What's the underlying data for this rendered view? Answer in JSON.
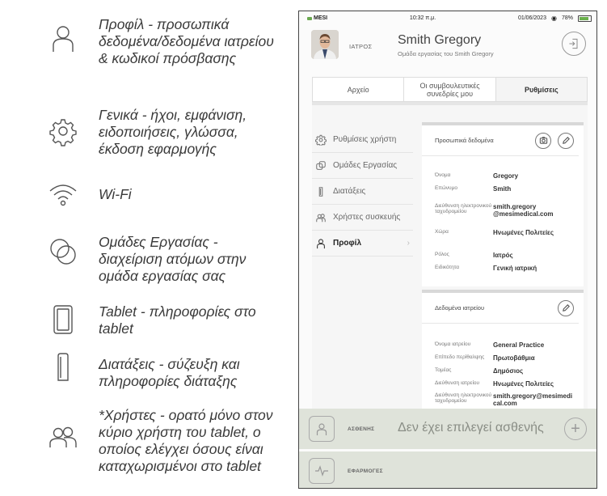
{
  "legend": [
    {
      "icon": "user-icon",
      "text": "Προφίλ - προσωπικά δεδομένα/δεδομένα ιατρείου & κωδικοί πρόσβασης"
    },
    {
      "icon": "gear-icon",
      "text": "Γενικά - ήχοι, εμφάνιση, ειδοποιήσεις, γλώσσα, έκδοση εφαρμογής"
    },
    {
      "icon": "wifi-icon",
      "text": "Wi-Fi"
    },
    {
      "icon": "workgroups-icon",
      "text": "Ομάδες Εργασίας - διαχείριση ατόμων στην ομάδα εργασίας σας"
    },
    {
      "icon": "tablet-icon",
      "text": "Tablet - πληροφορίες στο tablet"
    },
    {
      "icon": "device-icon",
      "text": "Διατάξεις - σύζευξη και πληροφορίες διάταξης"
    },
    {
      "icon": "users-icon",
      "text": "*Χρήστες - ορατό μόνο στον κύριο χρήστη του tablet, ο οποίος ελέγχει όσους είναι καταχωρισμένοι στο tablet"
    }
  ],
  "status": {
    "carrier": "MESI",
    "time": "10:32 π.μ.",
    "date": "01/06/2023",
    "battery": "78%"
  },
  "doctor": {
    "role": "ΙΑΤΡΟΣ",
    "name": "Smith Gregory",
    "group": "Ομάδα εργασίας του Smith Gregory"
  },
  "tabs": [
    "Αρχείο",
    "Οι συμβουλευτικές συνεδρίες μου",
    "Ρυθμίσεις"
  ],
  "menu": [
    {
      "icon": "gear-icon",
      "label": "Ρυθμίσεις χρήστη"
    },
    {
      "icon": "workgroups-icon",
      "label": "Ομάδες Εργασίας"
    },
    {
      "icon": "device-icon",
      "label": "Διατάξεις"
    },
    {
      "icon": "users-icon",
      "label": "Χρήστες συσκευής"
    },
    {
      "icon": "user-icon",
      "label": "Προφίλ"
    }
  ],
  "personal": {
    "title": "Προσωπικά δεδομένα",
    "rows": [
      {
        "k": "Όνομα",
        "v": "Gregory"
      },
      {
        "k": "Επώνυμο",
        "v": "Smith"
      },
      {
        "k": "Διεύθυνση ηλεκτρονικού ταχυδρομείου",
        "v": "smith.gregory @mesimedical.com"
      },
      {
        "k": "Χώρα",
        "v": "Ηνωμένες Πολιτείες"
      },
      {
        "k": "Ρόλος",
        "v": "Ιατρός"
      },
      {
        "k": "Ειδικότητα",
        "v": "Γενική ιατρική"
      }
    ]
  },
  "office": {
    "title": "Δεδομένα ιατρείου",
    "rows": [
      {
        "k": "Όνομα ιατρείου",
        "v": "General Practice"
      },
      {
        "k": "Επίπεδο περίθαλψης",
        "v": "Πρωτοβάθμια"
      },
      {
        "k": "Τομέας",
        "v": "Δημόσιος"
      },
      {
        "k": "Διεύθυνση ιατρείου",
        "v": "Ηνωμένες Πολιτείες"
      },
      {
        "k": "Διεύθυνση ηλεκτρονικού ταχυδρομείου",
        "v": "smith.gregory@mesimedi cal.com"
      }
    ]
  },
  "bottom": {
    "patients_label": "ΑΣΘΕΝΗΣ",
    "no_patient": "Δεν έχει επιλεγεί ασθενής",
    "apps_label": "ΕΦΑΡΜΟΓΕΣ"
  }
}
